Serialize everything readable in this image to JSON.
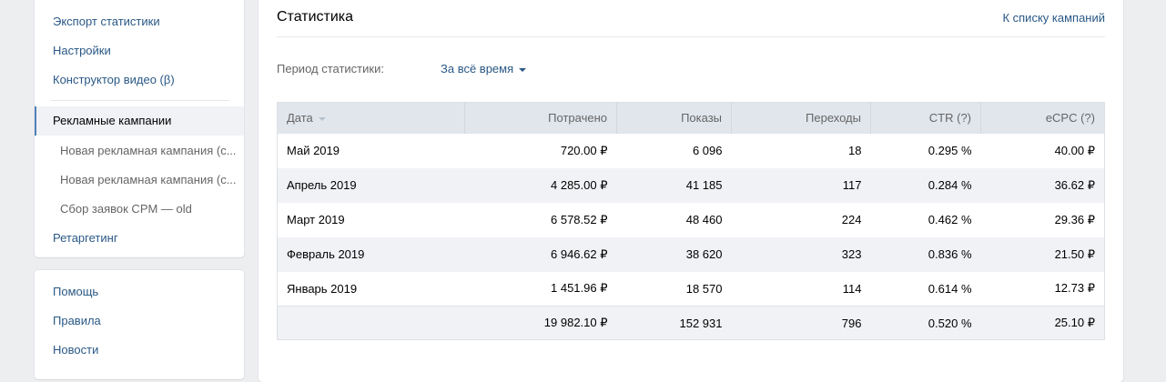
{
  "sidebar": {
    "items": [
      "Экспорт статистики",
      "Настройки",
      "Конструктор видео (β)"
    ],
    "active": "Рекламные кампании",
    "subitems": [
      "Новая рекламная кампания (с...",
      "Новая рекламная кампания (с...",
      "Сбор заявок CPM — old"
    ],
    "after": "Ретаргетинг",
    "help": [
      "Помощь",
      "Правила",
      "Новости"
    ]
  },
  "main": {
    "title": "Статистика",
    "back_link": "К списку кампаний",
    "period_label": "Период статистики:",
    "period_value": "За всё время"
  },
  "table": {
    "headers": [
      "Дата",
      "Потрачено",
      "Показы",
      "Переходы",
      "CTR (?)",
      "eCPC (?)"
    ],
    "rows": [
      [
        "Май 2019",
        "720.00 ₽",
        "6 096",
        "18",
        "0.295 %",
        "40.00 ₽"
      ],
      [
        "Апрель 2019",
        "4 285.00 ₽",
        "41 185",
        "117",
        "0.284 %",
        "36.62 ₽"
      ],
      [
        "Март 2019",
        "6 578.52 ₽",
        "48 460",
        "224",
        "0.462 %",
        "29.36 ₽"
      ],
      [
        "Февраль 2019",
        "6 946.62 ₽",
        "38 620",
        "323",
        "0.836 %",
        "21.50 ₽"
      ],
      [
        "Январь 2019",
        "1 451.96 ₽",
        "18 570",
        "114",
        "0.614 %",
        "12.73 ₽"
      ]
    ],
    "totals": [
      "",
      "19 982.10 ₽",
      "152 931",
      "796",
      "0.520 %",
      "25.10 ₽"
    ]
  }
}
